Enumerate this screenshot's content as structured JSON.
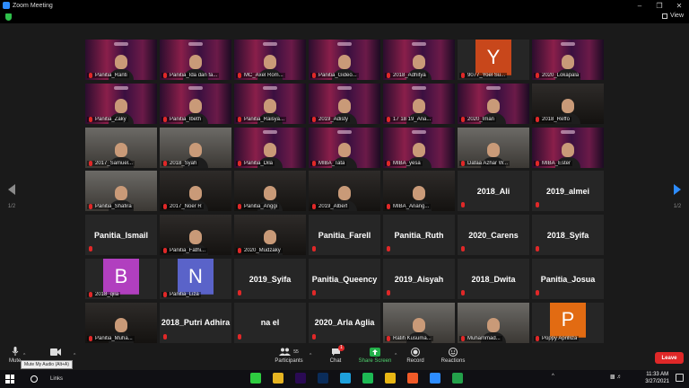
{
  "window": {
    "title": "Zoom Meeting"
  },
  "header": {
    "view_label": "View"
  },
  "pager": {
    "prev_page": "1/2",
    "next_page": "1/2"
  },
  "tiles": [
    {
      "name": "Panitia_Ranti",
      "kind": "video-orion"
    },
    {
      "name": "Panitia_Ida dan fa...",
      "kind": "video-orion",
      "active": true
    },
    {
      "name": "MC_Axel Rom...",
      "kind": "video-orion"
    },
    {
      "name": "Panitia_Gideo...",
      "kind": "video-orion"
    },
    {
      "name": "2018_Adhitya",
      "kind": "video-orion"
    },
    {
      "name": "9077_Yoel Su...",
      "kind": "avatar",
      "letter": "Y",
      "color": "#c8471b"
    },
    {
      "name": "2020_Lokapala",
      "kind": "video-orion"
    },
    {
      "name": "Panitia_Zaky",
      "kind": "video-orion"
    },
    {
      "name": "Panitia_Ibeth",
      "kind": "video-orion"
    },
    {
      "name": "Panitia_Raisya...",
      "kind": "video-orion"
    },
    {
      "name": "2019_Adisty",
      "kind": "video-orion"
    },
    {
      "name": "17 18 19_Ana...",
      "kind": "video-orion"
    },
    {
      "name": "2020_Iman",
      "kind": "video-orion"
    },
    {
      "name": "2018_Reffo",
      "kind": "video-room"
    },
    {
      "name": "2017_Samuel...",
      "kind": "video-photo"
    },
    {
      "name": "2018_Syah",
      "kind": "video-photo"
    },
    {
      "name": "Panitia_Dila",
      "kind": "video-orion"
    },
    {
      "name": "MIBA_Tata",
      "kind": "video-orion"
    },
    {
      "name": "MIBA_yesa",
      "kind": "video-orion"
    },
    {
      "name": "Dafaa Azhar W...",
      "kind": "video-photo"
    },
    {
      "name": "MIBA_Ester",
      "kind": "video-orion"
    },
    {
      "name": "Panitia_Shafira",
      "kind": "video-photo"
    },
    {
      "name": "2017_Noer R",
      "kind": "video-room"
    },
    {
      "name": "Panitia_Anggi",
      "kind": "video-room"
    },
    {
      "name": "2019_Albert",
      "kind": "video-room"
    },
    {
      "name": "MIBA_Anang...",
      "kind": "video-room"
    },
    {
      "name": "2018_Ali",
      "kind": "name"
    },
    {
      "name": "2019_almei",
      "kind": "name"
    },
    {
      "name": "Panitia_Ismail",
      "kind": "name"
    },
    {
      "name": "Panitia_Fathi...",
      "kind": "video-room"
    },
    {
      "name": "2020_Mudzaky",
      "kind": "video-room"
    },
    {
      "name": "Panitia_Farell",
      "kind": "name"
    },
    {
      "name": "Panitia_Ruth",
      "kind": "name"
    },
    {
      "name": "2020_Carens",
      "kind": "name"
    },
    {
      "name": "2018_Syifa",
      "kind": "name"
    },
    {
      "name": "2018_qila",
      "kind": "avatar",
      "letter": "B",
      "color": "#b13fbf"
    },
    {
      "name": "Panitia_Liza",
      "kind": "avatar",
      "letter": "N",
      "color": "#5a63c9"
    },
    {
      "name": "2019_Syifa",
      "kind": "name"
    },
    {
      "name": "Panitia_Queency",
      "kind": "name"
    },
    {
      "name": "2019_Aisyah",
      "kind": "name"
    },
    {
      "name": "2018_Dwita",
      "kind": "name"
    },
    {
      "name": "Panitia_Josua",
      "kind": "name"
    },
    {
      "name": "Panitia_Muha...",
      "kind": "video-room"
    },
    {
      "name": "2018_Putri Adhira",
      "kind": "name"
    },
    {
      "name": "na el",
      "kind": "name"
    },
    {
      "name": "2020_Arla Aglia",
      "kind": "name"
    },
    {
      "name": "Ratih Kusuma...",
      "kind": "video-photo"
    },
    {
      "name": "Muhammad...",
      "kind": "video-photo"
    },
    {
      "name": "Poppy Aprilliza",
      "kind": "avatar",
      "letter": "P",
      "color": "#e26b12"
    }
  ],
  "toolbar": {
    "mute_label": "Mute",
    "mute_tooltip": "Mute My Audio (Alt+A)",
    "participants_label": "Participants",
    "participants_count": "55",
    "chat_label": "Chat",
    "chat_badge": "1",
    "share_label": "Share Screen",
    "record_label": "Record",
    "reactions_label": "Reactions",
    "leave_label": "Leave"
  },
  "taskbar": {
    "links_label": "Links",
    "time": "11:33 AM",
    "date": "3/27/2021",
    "apps": [
      {
        "icon": "line-icon",
        "color": "#2ecc40"
      },
      {
        "icon": "file-explorer-icon",
        "color": "#e6b422"
      },
      {
        "icon": "premiere-icon",
        "color": "#2a0a54"
      },
      {
        "icon": "photoshop-icon",
        "color": "#0a2c5a"
      },
      {
        "icon": "lightroom-l-icon",
        "color": "#1ea0dc"
      },
      {
        "icon": "spotify-icon",
        "color": "#1db954"
      },
      {
        "icon": "chrome-icon",
        "color": "#e8b614"
      },
      {
        "icon": "brave-icon",
        "color": "#f05a28"
      },
      {
        "icon": "zoom-icon",
        "color": "#2d8cff"
      },
      {
        "icon": "app-green-icon",
        "color": "#23a04a"
      }
    ]
  }
}
